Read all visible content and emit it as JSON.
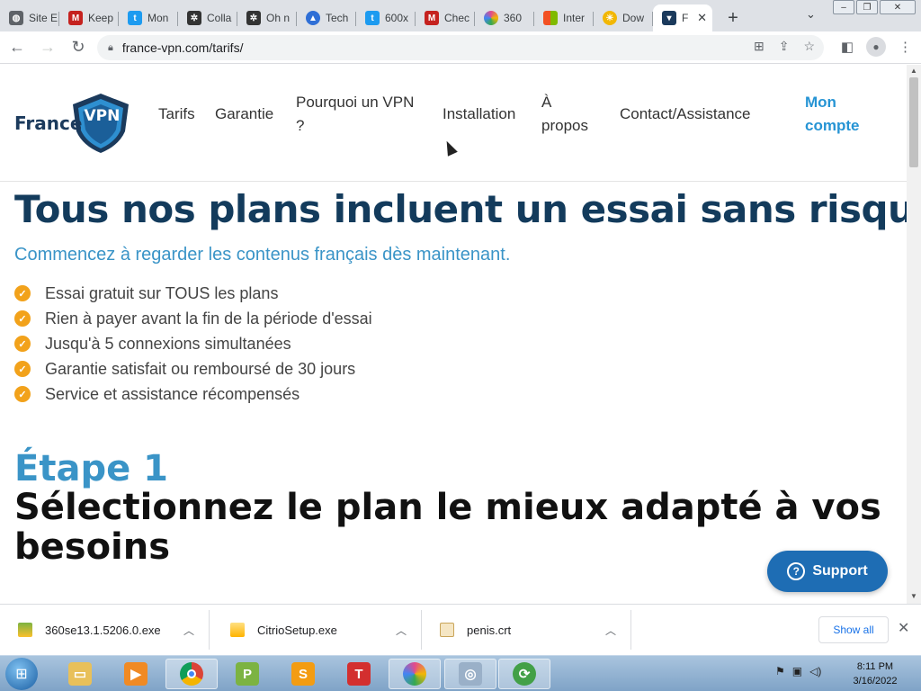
{
  "browser": {
    "tabs": [
      {
        "label": "Site E",
        "icon": "globe-icon",
        "color": "#5f6368"
      },
      {
        "label": "Keep",
        "icon": "red-m-icon",
        "color": "#c5221f"
      },
      {
        "label": "Mon",
        "icon": "twitter-icon",
        "color": "#1d9bf0"
      },
      {
        "label": "Colla",
        "icon": "openai-icon",
        "color": "#333333"
      },
      {
        "label": "Oh n",
        "icon": "openai-icon",
        "color": "#333333"
      },
      {
        "label": "Tech",
        "icon": "triangle-icon",
        "color": "#2f6fd6"
      },
      {
        "label": "600x",
        "icon": "twitter-icon",
        "color": "#1d9bf0"
      },
      {
        "label": "Chec",
        "icon": "red-m-icon",
        "color": "#c5221f"
      },
      {
        "label": "360",
        "icon": "pinwheel-icon",
        "color": "#e24a8d"
      },
      {
        "label": "Inter",
        "icon": "windows-icon",
        "color": "#0078d4"
      },
      {
        "label": "Dow",
        "icon": "sun-icon",
        "color": "#f2b705"
      },
      {
        "label": "F",
        "icon": "shield-icon",
        "color": "#1b3a5c"
      }
    ],
    "new_tab": "+",
    "tab_search": "⌄",
    "url": "france-vpn.com/tarifs/"
  },
  "site": {
    "logo_text": "France",
    "logo_badge": "VPN",
    "nav": [
      {
        "label": "Tarifs"
      },
      {
        "label": "Garantie"
      },
      {
        "label_line1": "Pourquoi un VPN",
        "label_line2": "?"
      },
      {
        "label": "Installation"
      },
      {
        "label_line1": "À",
        "label_line2": "propos"
      },
      {
        "label": "Contact/Assistance"
      },
      {
        "label_line1": "Mon",
        "label_line2": "compte"
      }
    ],
    "heading": "Tous nos plans incluent un essai sans risque",
    "subheading": "Commencez à regarder les contenus français dès maintenant.",
    "features": [
      "Essai gratuit sur TOUS les plans",
      "Rien à payer avant la fin de la période d'essai",
      "Jusqu'à 5 connexions simultanées",
      "Garantie satisfait ou remboursé de 30 jours",
      "Service et assistance récompensés"
    ],
    "step_label": "Étape 1",
    "step_heading": "Sélectionnez le plan le mieux adapté à vos besoins",
    "support_label": "Support",
    "colors": {
      "navy": "#133b5c",
      "accent": "#3a94c7",
      "check": "#f2a21b",
      "support": "#1e6db4"
    }
  },
  "downloads": {
    "items": [
      {
        "name": "360se13.1.5206.0.exe",
        "icon": "installer-icon"
      },
      {
        "name": "CitrioSetup.exe",
        "icon": "installer-icon"
      },
      {
        "name": "penis.crt",
        "icon": "certificate-icon"
      }
    ],
    "show_all": "Show all"
  },
  "taskbar": {
    "apps": [
      "explorer-icon",
      "media-player-icon",
      "chrome-icon",
      "p-app-icon",
      "s-app-icon",
      "t-app-icon",
      "pinwheel-icon",
      "installer-icon",
      "refresh-app-icon"
    ],
    "time": "8:11 PM",
    "date": "3/16/2022"
  }
}
